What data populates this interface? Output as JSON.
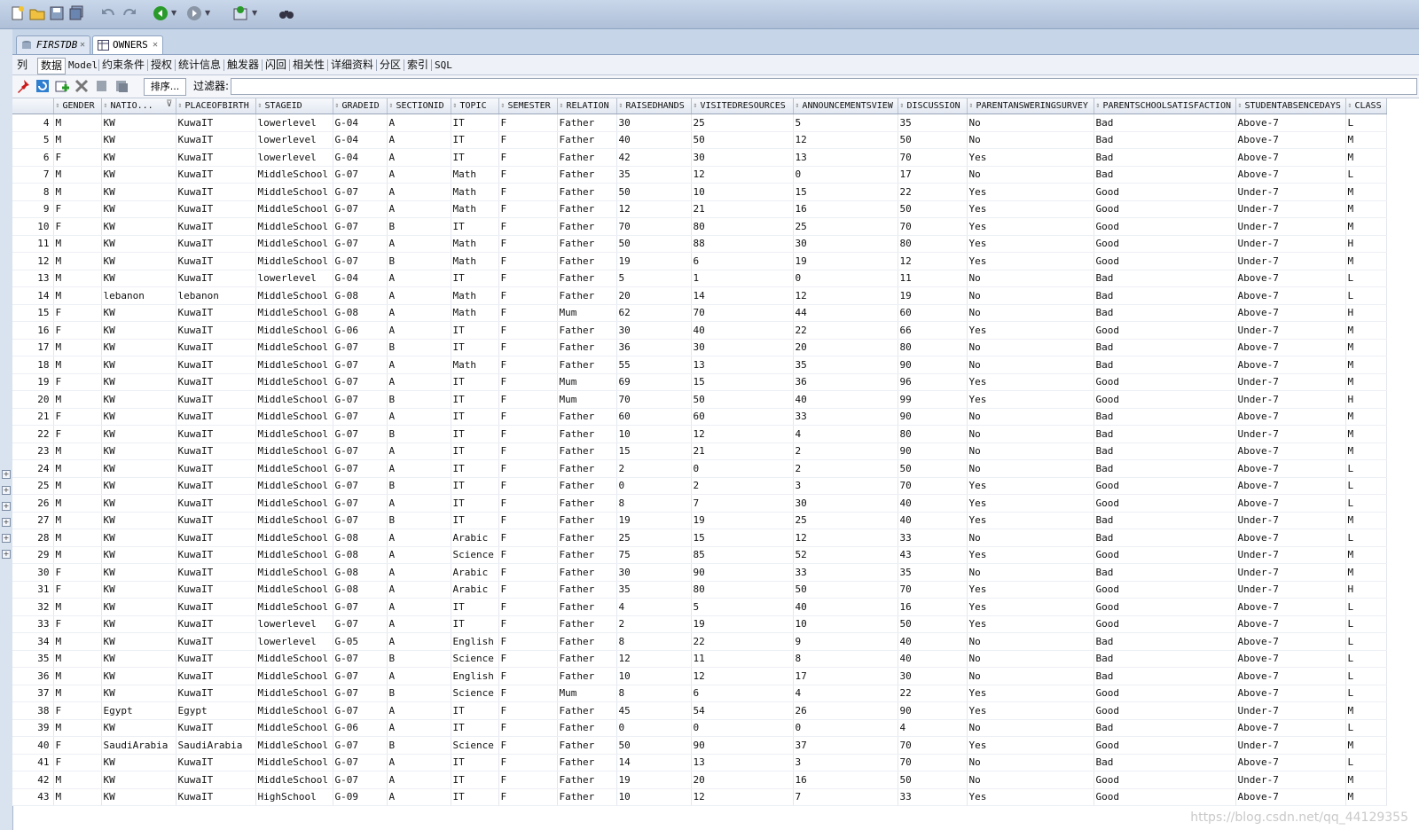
{
  "toolbar": {
    "buttons": [
      "new-file",
      "open-folder",
      "save",
      "save-all",
      "undo",
      "redo",
      "back",
      "forward",
      "sql-worksheet",
      "find"
    ]
  },
  "tabs": [
    {
      "label": "FIRSTDB",
      "active": false
    },
    {
      "label": "OWNERS",
      "active": true
    }
  ],
  "subtabs": [
    "列",
    "数据",
    "Model",
    "约束条件",
    "授权",
    "统计信息",
    "触发器",
    "闪回",
    "相关性",
    "详细资料",
    "分区",
    "索引",
    "SQL"
  ],
  "action_bar": {
    "sort_label": "排序...",
    "filter_label": "过滤器:"
  },
  "columns": [
    "GENDER",
    "NATIO...",
    "PLACEOFBIRTH",
    "STAGEID",
    "GRADEID",
    "SECTIONID",
    "TOPIC",
    "SEMESTER",
    "RELATION",
    "RAISEDHANDS",
    "VISITEDRESOURCES",
    "ANNOUNCEMENTSVIEW",
    "DISCUSSION",
    "PARENTANSWERINGSURVEY",
    "PARENTSCHOOLSATISFACTION",
    "STUDENTABSENCEDAYS",
    "CLASS"
  ],
  "rows": [
    [
      "4",
      "M",
      "KW",
      "KuwaIT",
      "lowerlevel",
      "G-04",
      "A",
      "IT",
      "F",
      "Father",
      "30",
      "25",
      "5",
      "35",
      "No",
      "Bad",
      "Above-7",
      "L"
    ],
    [
      "5",
      "M",
      "KW",
      "KuwaIT",
      "lowerlevel",
      "G-04",
      "A",
      "IT",
      "F",
      "Father",
      "40",
      "50",
      "12",
      "50",
      "No",
      "Bad",
      "Above-7",
      "M"
    ],
    [
      "6",
      "F",
      "KW",
      "KuwaIT",
      "lowerlevel",
      "G-04",
      "A",
      "IT",
      "F",
      "Father",
      "42",
      "30",
      "13",
      "70",
      "Yes",
      "Bad",
      "Above-7",
      "M"
    ],
    [
      "7",
      "M",
      "KW",
      "KuwaIT",
      "MiddleSchool",
      "G-07",
      "A",
      "Math",
      "F",
      "Father",
      "35",
      "12",
      "0",
      "17",
      "No",
      "Bad",
      "Above-7",
      "L"
    ],
    [
      "8",
      "M",
      "KW",
      "KuwaIT",
      "MiddleSchool",
      "G-07",
      "A",
      "Math",
      "F",
      "Father",
      "50",
      "10",
      "15",
      "22",
      "Yes",
      "Good",
      "Under-7",
      "M"
    ],
    [
      "9",
      "F",
      "KW",
      "KuwaIT",
      "MiddleSchool",
      "G-07",
      "A",
      "Math",
      "F",
      "Father",
      "12",
      "21",
      "16",
      "50",
      "Yes",
      "Good",
      "Under-7",
      "M"
    ],
    [
      "10",
      "F",
      "KW",
      "KuwaIT",
      "MiddleSchool",
      "G-07",
      "B",
      "IT",
      "F",
      "Father",
      "70",
      "80",
      "25",
      "70",
      "Yes",
      "Good",
      "Under-7",
      "M"
    ],
    [
      "11",
      "M",
      "KW",
      "KuwaIT",
      "MiddleSchool",
      "G-07",
      "A",
      "Math",
      "F",
      "Father",
      "50",
      "88",
      "30",
      "80",
      "Yes",
      "Good",
      "Under-7",
      "H"
    ],
    [
      "12",
      "M",
      "KW",
      "KuwaIT",
      "MiddleSchool",
      "G-07",
      "B",
      "Math",
      "F",
      "Father",
      "19",
      "6",
      "19",
      "12",
      "Yes",
      "Good",
      "Under-7",
      "M"
    ],
    [
      "13",
      "M",
      "KW",
      "KuwaIT",
      "lowerlevel",
      "G-04",
      "A",
      "IT",
      "F",
      "Father",
      "5",
      "1",
      "0",
      "11",
      "No",
      "Bad",
      "Above-7",
      "L"
    ],
    [
      "14",
      "M",
      "lebanon",
      "lebanon",
      "MiddleSchool",
      "G-08",
      "A",
      "Math",
      "F",
      "Father",
      "20",
      "14",
      "12",
      "19",
      "No",
      "Bad",
      "Above-7",
      "L"
    ],
    [
      "15",
      "F",
      "KW",
      "KuwaIT",
      "MiddleSchool",
      "G-08",
      "A",
      "Math",
      "F",
      "Mum",
      "62",
      "70",
      "44",
      "60",
      "No",
      "Bad",
      "Above-7",
      "H"
    ],
    [
      "16",
      "F",
      "KW",
      "KuwaIT",
      "MiddleSchool",
      "G-06",
      "A",
      "IT",
      "F",
      "Father",
      "30",
      "40",
      "22",
      "66",
      "Yes",
      "Good",
      "Under-7",
      "M"
    ],
    [
      "17",
      "M",
      "KW",
      "KuwaIT",
      "MiddleSchool",
      "G-07",
      "B",
      "IT",
      "F",
      "Father",
      "36",
      "30",
      "20",
      "80",
      "No",
      "Bad",
      "Above-7",
      "M"
    ],
    [
      "18",
      "M",
      "KW",
      "KuwaIT",
      "MiddleSchool",
      "G-07",
      "A",
      "Math",
      "F",
      "Father",
      "55",
      "13",
      "35",
      "90",
      "No",
      "Bad",
      "Above-7",
      "M"
    ],
    [
      "19",
      "F",
      "KW",
      "KuwaIT",
      "MiddleSchool",
      "G-07",
      "A",
      "IT",
      "F",
      "Mum",
      "69",
      "15",
      "36",
      "96",
      "Yes",
      "Good",
      "Under-7",
      "M"
    ],
    [
      "20",
      "M",
      "KW",
      "KuwaIT",
      "MiddleSchool",
      "G-07",
      "B",
      "IT",
      "F",
      "Mum",
      "70",
      "50",
      "40",
      "99",
      "Yes",
      "Good",
      "Under-7",
      "H"
    ],
    [
      "21",
      "F",
      "KW",
      "KuwaIT",
      "MiddleSchool",
      "G-07",
      "A",
      "IT",
      "F",
      "Father",
      "60",
      "60",
      "33",
      "90",
      "No",
      "Bad",
      "Above-7",
      "M"
    ],
    [
      "22",
      "F",
      "KW",
      "KuwaIT",
      "MiddleSchool",
      "G-07",
      "B",
      "IT",
      "F",
      "Father",
      "10",
      "12",
      "4",
      "80",
      "No",
      "Bad",
      "Under-7",
      "M"
    ],
    [
      "23",
      "M",
      "KW",
      "KuwaIT",
      "MiddleSchool",
      "G-07",
      "A",
      "IT",
      "F",
      "Father",
      "15",
      "21",
      "2",
      "90",
      "No",
      "Bad",
      "Above-7",
      "M"
    ],
    [
      "24",
      "M",
      "KW",
      "KuwaIT",
      "MiddleSchool",
      "G-07",
      "A",
      "IT",
      "F",
      "Father",
      "2",
      "0",
      "2",
      "50",
      "No",
      "Bad",
      "Above-7",
      "L"
    ],
    [
      "25",
      "M",
      "KW",
      "KuwaIT",
      "MiddleSchool",
      "G-07",
      "B",
      "IT",
      "F",
      "Father",
      "0",
      "2",
      "3",
      "70",
      "Yes",
      "Good",
      "Above-7",
      "L"
    ],
    [
      "26",
      "M",
      "KW",
      "KuwaIT",
      "MiddleSchool",
      "G-07",
      "A",
      "IT",
      "F",
      "Father",
      "8",
      "7",
      "30",
      "40",
      "Yes",
      "Good",
      "Above-7",
      "L"
    ],
    [
      "27",
      "M",
      "KW",
      "KuwaIT",
      "MiddleSchool",
      "G-07",
      "B",
      "IT",
      "F",
      "Father",
      "19",
      "19",
      "25",
      "40",
      "Yes",
      "Bad",
      "Under-7",
      "M"
    ],
    [
      "28",
      "M",
      "KW",
      "KuwaIT",
      "MiddleSchool",
      "G-08",
      "A",
      "Arabic",
      "F",
      "Father",
      "25",
      "15",
      "12",
      "33",
      "No",
      "Bad",
      "Above-7",
      "L"
    ],
    [
      "29",
      "M",
      "KW",
      "KuwaIT",
      "MiddleSchool",
      "G-08",
      "A",
      "Science",
      "F",
      "Father",
      "75",
      "85",
      "52",
      "43",
      "Yes",
      "Good",
      "Under-7",
      "M"
    ],
    [
      "30",
      "F",
      "KW",
      "KuwaIT",
      "MiddleSchool",
      "G-08",
      "A",
      "Arabic",
      "F",
      "Father",
      "30",
      "90",
      "33",
      "35",
      "No",
      "Bad",
      "Under-7",
      "M"
    ],
    [
      "31",
      "F",
      "KW",
      "KuwaIT",
      "MiddleSchool",
      "G-08",
      "A",
      "Arabic",
      "F",
      "Father",
      "35",
      "80",
      "50",
      "70",
      "Yes",
      "Good",
      "Under-7",
      "H"
    ],
    [
      "32",
      "M",
      "KW",
      "KuwaIT",
      "MiddleSchool",
      "G-07",
      "A",
      "IT",
      "F",
      "Father",
      "4",
      "5",
      "40",
      "16",
      "Yes",
      "Good",
      "Above-7",
      "L"
    ],
    [
      "33",
      "F",
      "KW",
      "KuwaIT",
      "lowerlevel",
      "G-07",
      "A",
      "IT",
      "F",
      "Father",
      "2",
      "19",
      "10",
      "50",
      "Yes",
      "Good",
      "Above-7",
      "L"
    ],
    [
      "34",
      "M",
      "KW",
      "KuwaIT",
      "lowerlevel",
      "G-05",
      "A",
      "English",
      "F",
      "Father",
      "8",
      "22",
      "9",
      "40",
      "No",
      "Bad",
      "Above-7",
      "L"
    ],
    [
      "35",
      "M",
      "KW",
      "KuwaIT",
      "MiddleSchool",
      "G-07",
      "B",
      "Science",
      "F",
      "Father",
      "12",
      "11",
      "8",
      "40",
      "No",
      "Bad",
      "Above-7",
      "L"
    ],
    [
      "36",
      "M",
      "KW",
      "KuwaIT",
      "MiddleSchool",
      "G-07",
      "A",
      "English",
      "F",
      "Father",
      "10",
      "12",
      "17",
      "30",
      "No",
      "Bad",
      "Above-7",
      "L"
    ],
    [
      "37",
      "M",
      "KW",
      "KuwaIT",
      "MiddleSchool",
      "G-07",
      "B",
      "Science",
      "F",
      "Mum",
      "8",
      "6",
      "4",
      "22",
      "Yes",
      "Good",
      "Above-7",
      "L"
    ],
    [
      "38",
      "F",
      "Egypt",
      "Egypt",
      "MiddleSchool",
      "G-07",
      "A",
      "IT",
      "F",
      "Father",
      "45",
      "54",
      "26",
      "90",
      "Yes",
      "Good",
      "Under-7",
      "M"
    ],
    [
      "39",
      "M",
      "KW",
      "KuwaIT",
      "MiddleSchool",
      "G-06",
      "A",
      "IT",
      "F",
      "Father",
      "0",
      "0",
      "0",
      "4",
      "No",
      "Bad",
      "Above-7",
      "L"
    ],
    [
      "40",
      "F",
      "SaudiArabia",
      "SaudiArabia",
      "MiddleSchool",
      "G-07",
      "B",
      "Science",
      "F",
      "Father",
      "50",
      "90",
      "37",
      "70",
      "Yes",
      "Good",
      "Under-7",
      "M"
    ],
    [
      "41",
      "F",
      "KW",
      "KuwaIT",
      "MiddleSchool",
      "G-07",
      "A",
      "IT",
      "F",
      "Father",
      "14",
      "13",
      "3",
      "70",
      "No",
      "Bad",
      "Above-7",
      "L"
    ],
    [
      "42",
      "M",
      "KW",
      "KuwaIT",
      "MiddleSchool",
      "G-07",
      "A",
      "IT",
      "F",
      "Father",
      "19",
      "20",
      "16",
      "50",
      "No",
      "Good",
      "Under-7",
      "M"
    ],
    [
      "43",
      "M",
      "KW",
      "KuwaIT",
      "HighSchool",
      "G-09",
      "A",
      "IT",
      "F",
      "Father",
      "10",
      "12",
      "7",
      "33",
      "Yes",
      "Good",
      "Above-7",
      "M"
    ]
  ],
  "watermark": "https://blog.csdn.net/qq_44129355",
  "colors": {
    "toolbar_bg": "#aebfd7",
    "tab_active": "#ffffff",
    "header_bg": "#e2e8f1",
    "accent_red": "#cc1a1a",
    "accent_green": "#2a9a2a"
  }
}
